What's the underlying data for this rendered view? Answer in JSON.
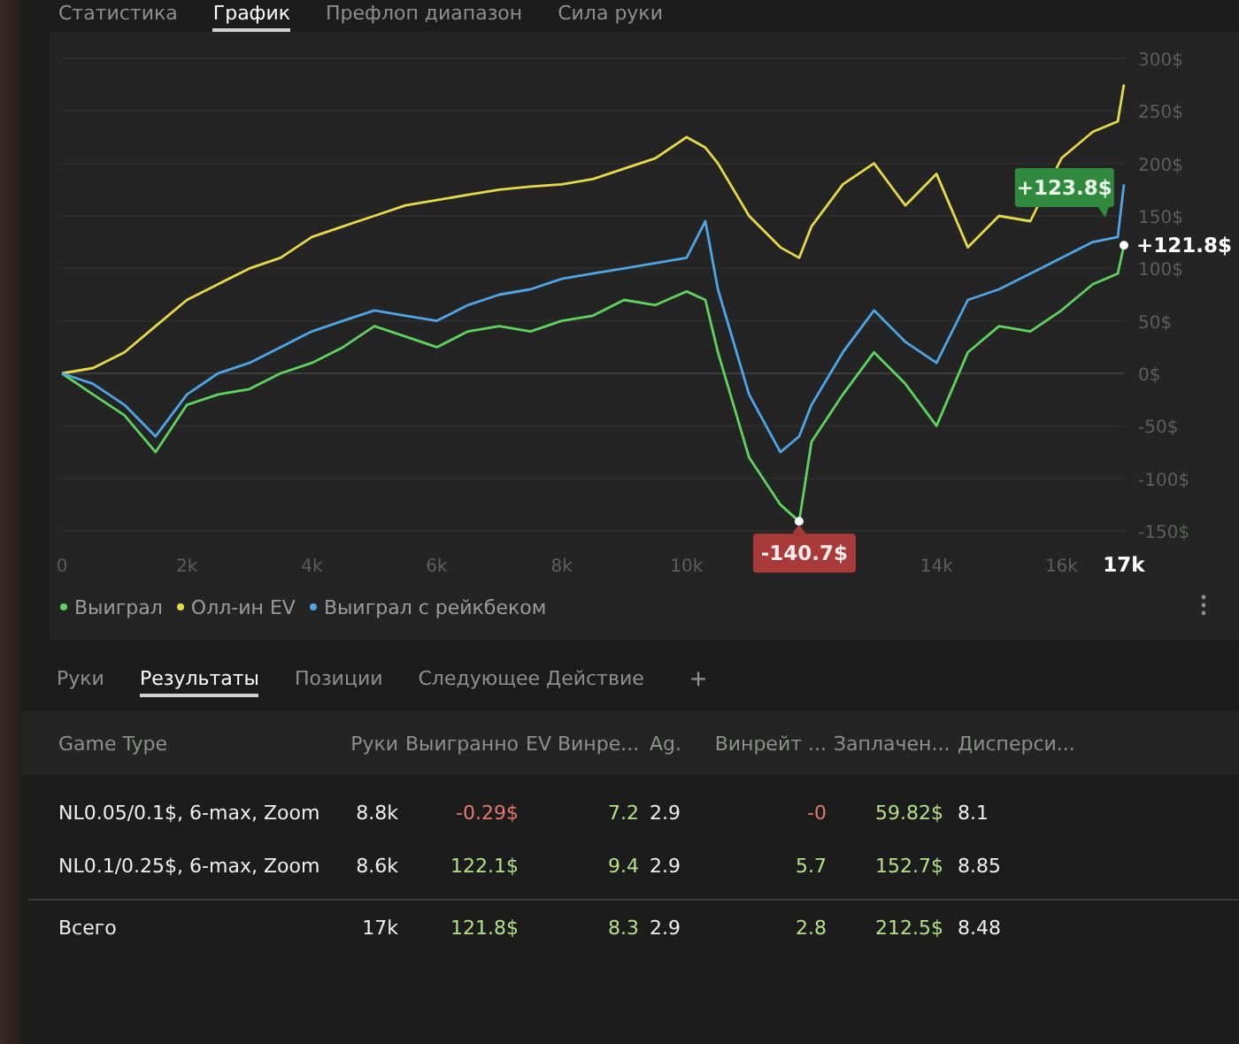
{
  "top_tabs": [
    {
      "label": "Статистика",
      "selected": false
    },
    {
      "label": "График",
      "selected": true
    },
    {
      "label": "Префлоп диапазон",
      "selected": false
    },
    {
      "label": "Сила руки",
      "selected": false
    }
  ],
  "chart": {
    "cursor_label": "17k",
    "chart_data": {
      "type": "line",
      "grid": true,
      "x": [
        0,
        500,
        1000,
        1500,
        2000,
        2500,
        3000,
        3500,
        4000,
        4500,
        5000,
        5500,
        6000,
        6500,
        7000,
        7500,
        8000,
        8500,
        9000,
        9500,
        10000,
        10300,
        10500,
        11000,
        11500,
        11800,
        12000,
        12500,
        13000,
        13500,
        14000,
        14500,
        15000,
        15500,
        16000,
        16500,
        16900,
        17000
      ],
      "series": [
        {
          "name": "Выиграл",
          "color": "#5fd35f",
          "values": [
            0,
            -20,
            -40,
            -75,
            -30,
            -20,
            -15,
            0,
            10,
            25,
            45,
            35,
            25,
            40,
            45,
            40,
            50,
            55,
            70,
            65,
            78,
            70,
            20,
            -80,
            -125,
            -141,
            -65,
            -20,
            20,
            -10,
            -50,
            20,
            45,
            40,
            60,
            85,
            95,
            122
          ]
        },
        {
          "name": "Олл-ин EV",
          "color": "#e6d94a",
          "values": [
            0,
            5,
            20,
            45,
            70,
            85,
            100,
            110,
            130,
            140,
            150,
            160,
            165,
            170,
            175,
            178,
            180,
            185,
            195,
            205,
            225,
            215,
            200,
            150,
            120,
            110,
            140,
            180,
            200,
            160,
            190,
            120,
            150,
            145,
            205,
            230,
            240,
            275
          ]
        },
        {
          "name": "Выиграл с рейкбеком",
          "color": "#4ea6e6",
          "values": [
            0,
            -10,
            -30,
            -60,
            -20,
            0,
            10,
            25,
            40,
            50,
            60,
            55,
            50,
            65,
            75,
            80,
            90,
            95,
            100,
            105,
            110,
            145,
            80,
            -20,
            -75,
            -60,
            -30,
            20,
            60,
            30,
            10,
            70,
            80,
            95,
            110,
            125,
            130,
            180
          ]
        }
      ],
      "xlim": [
        0,
        17000
      ],
      "ylim": [
        -150,
        300
      ],
      "xticks": [
        0,
        {
          "value": 2000,
          "label": "2k"
        },
        {
          "value": 4000,
          "label": "4k"
        },
        {
          "value": 6000,
          "label": "6k"
        },
        {
          "value": 8000,
          "label": "8k"
        },
        {
          "value": 10000,
          "label": "10k"
        },
        {
          "value": 14000,
          "label": "14k"
        },
        {
          "value": 16000,
          "label": "16k"
        }
      ],
      "yticks": [
        {
          "value": 300,
          "label": "300$"
        },
        {
          "value": 250,
          "label": "250$"
        },
        {
          "value": 200,
          "label": "200$"
        },
        {
          "value": 150,
          "label": "150$"
        },
        {
          "value": 100,
          "label": "100$"
        },
        {
          "value": 50,
          "label": "50$"
        },
        {
          "value": 0,
          "label": "0$"
        },
        {
          "value": -50,
          "label": "-50$"
        },
        {
          "value": -100,
          "label": "-100$"
        },
        {
          "value": -150,
          "label": "-150$"
        }
      ],
      "annotations": [
        {
          "x": 16700,
          "y": 150,
          "text": "+123.8$"
        },
        {
          "x": 17000,
          "y": 122,
          "text": "+121.8$"
        },
        {
          "x": 11800,
          "y": -141,
          "text": "-140.7$"
        }
      ]
    }
  },
  "bottom_tabs": [
    {
      "label": "Руки",
      "selected": false
    },
    {
      "label": "Результаты",
      "selected": true
    },
    {
      "label": "Позиции",
      "selected": false
    },
    {
      "label": "Следующее Действие",
      "selected": false
    }
  ],
  "add_tab": "+",
  "table": {
    "columns": [
      "Game Type",
      "Руки",
      "Выигранно",
      "EV Винре...",
      "Ag.",
      "Винрейт ...",
      "Заплачен...",
      "Дисперси..."
    ],
    "rows": [
      {
        "cells": [
          {
            "text": "NL0.05/0.1$, 6-max, Zoom"
          },
          {
            "text": "8.8k"
          },
          {
            "text": "-0.29$",
            "color": "#e07a6e"
          },
          {
            "text": "7.2",
            "color": "#b5e08a"
          },
          {
            "text": "2.9"
          },
          {
            "text": "-0",
            "color": "#e07a6e"
          },
          {
            "text": "59.82$",
            "color": "#b5e08a"
          },
          {
            "text": "8.1"
          }
        ]
      },
      {
        "cells": [
          {
            "text": "NL0.1/0.25$, 6-max, Zoom"
          },
          {
            "text": "8.6k"
          },
          {
            "text": "122.1$",
            "color": "#b5e08a"
          },
          {
            "text": "9.4",
            "color": "#b5e08a"
          },
          {
            "text": "2.9"
          },
          {
            "text": "5.7",
            "color": "#b5e08a"
          },
          {
            "text": "152.7$",
            "color": "#b5e08a"
          },
          {
            "text": "8.85"
          }
        ]
      }
    ],
    "total_row": {
      "cells": [
        {
          "text": "Всего"
        },
        {
          "text": "17k"
        },
        {
          "text": "121.8$",
          "color": "#b5e08a"
        },
        {
          "text": "8.3",
          "color": "#b5e08a"
        },
        {
          "text": "2.9"
        },
        {
          "text": "2.8",
          "color": "#b5e08a"
        },
        {
          "text": "212.5$",
          "color": "#b5e08a"
        },
        {
          "text": "8.48"
        }
      ]
    }
  }
}
